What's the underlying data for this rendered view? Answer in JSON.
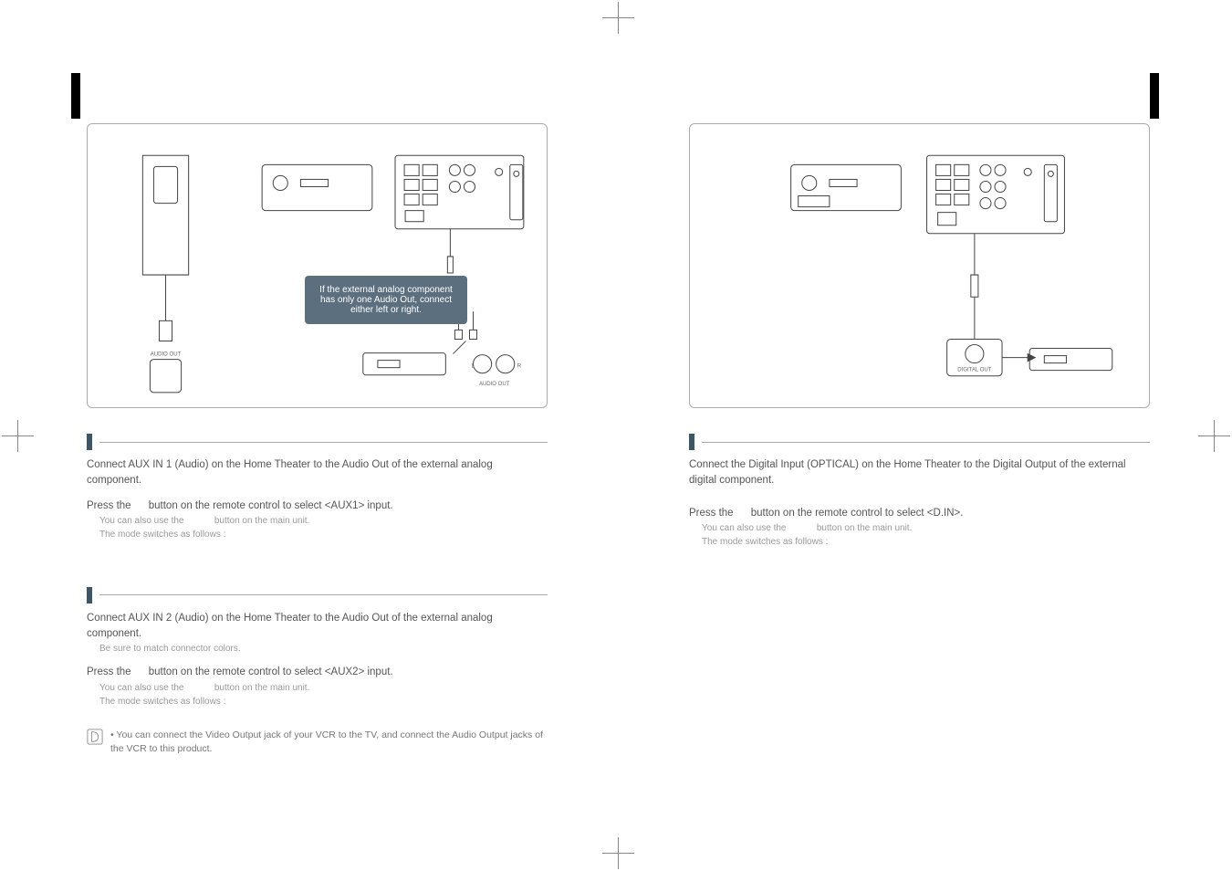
{
  "left": {
    "bubble": "If the external analog component has only one Audio Out, connect either left or right.",
    "aux1_step1": "Connect AUX IN 1 (Audio) on the Home Theater to the Audio Out of the external analog component.",
    "aux1_step2_a": "Press the",
    "aux1_step2_b": "button on the remote control to select <AUX1> input.",
    "aux1_sm1_a": "You can also use the",
    "aux1_sm1_b": "button on the main unit.",
    "aux1_sm2": "The mode switches as follows :",
    "aux2_step1": "Connect AUX IN 2 (Audio) on the Home Theater to the Audio Out of the external analog component.",
    "aux2_step1_sm": "Be sure to match connector colors.",
    "aux2_step2_a": "Press the",
    "aux2_step2_b": "button on the remote control to select <AUX2> input.",
    "aux2_sm1_a": "You can also use the",
    "aux2_sm1_b": "button on the main unit.",
    "aux2_sm2": "The mode switches as follows :",
    "note": "You can connect the Video Output jack of your VCR to the TV, and connect the Audio Output jacks of the VCR to this product."
  },
  "right": {
    "din_step1": "Connect the Digital Input (OPTICAL) on the Home Theater to the Digital Output of the external digital component.",
    "din_step2_a": "Press the",
    "din_step2_b": "button on the remote control to select <D.IN>.",
    "din_sm1_a": "You can also use the",
    "din_sm1_b": "button on the main unit.",
    "din_sm2": "The mode switches as follows :",
    "port_label": "DIGITAL OUT",
    "audio_out_label": "AUDIO OUT"
  }
}
